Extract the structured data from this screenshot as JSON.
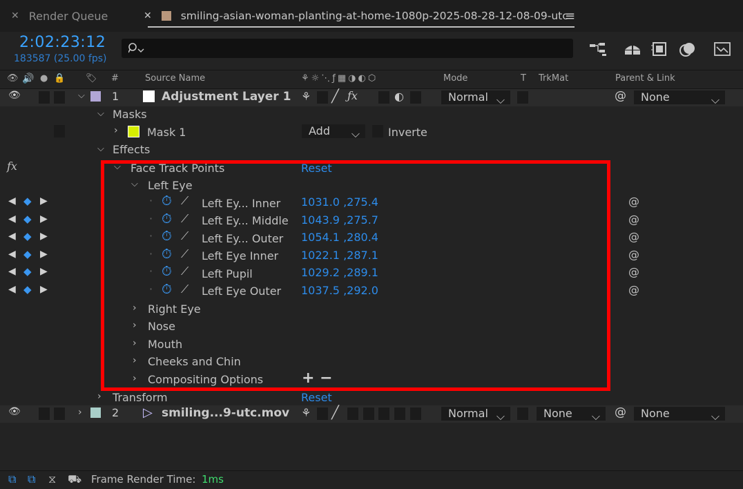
{
  "tabs": {
    "render_queue": "Render Queue",
    "comp": "smiling-asian-woman-planting-at-home-1080p-2025-08-28-12-08-09-utc"
  },
  "timecode": "2:02:23:12",
  "frames": "183587 (25.00 fps)",
  "columns": {
    "hash": "#",
    "source_name": "Source Name",
    "mode": "Mode",
    "t": "T",
    "trkmat": "TrkMat",
    "parent": "Parent & Link"
  },
  "layer1": {
    "num": "1",
    "name": "Adjustment Layer 1",
    "mode": "Normal",
    "parent": "None"
  },
  "masks_label": "Masks",
  "mask1": {
    "name": "Mask 1",
    "mode": "Add",
    "inverted_label": "Inverte",
    "color": "#d6ee00"
  },
  "effects_label": "Effects",
  "fx_label": "fx",
  "effect": {
    "name": "Face Track Points",
    "reset": "Reset"
  },
  "left_eye_group": "Left Eye",
  "left_eye_props": [
    {
      "name": "Left Ey... Inner",
      "value": "1031.0 ,275.4"
    },
    {
      "name": "Left Ey... Middle",
      "value": "1043.9 ,275.7"
    },
    {
      "name": "Left Ey... Outer",
      "value": "1054.1 ,280.4"
    },
    {
      "name": "Left Eye Inner",
      "value": "1022.1 ,287.1"
    },
    {
      "name": "Left Pupil",
      "value": "1029.2 ,289.1"
    },
    {
      "name": "Left Eye Outer",
      "value": "1037.5 ,292.0"
    }
  ],
  "groups": [
    "Right Eye",
    "Nose",
    "Mouth",
    "Cheeks and Chin",
    "Compositing Options"
  ],
  "compositing_buttons": "+ −",
  "transform": {
    "label": "Transform",
    "reset": "Reset"
  },
  "layer2": {
    "num": "2",
    "name": "smiling...9-utc.mov",
    "mode": "Normal",
    "trkmat": "None",
    "parent": "None"
  },
  "status": {
    "label": "Frame Render Time:",
    "value": "1ms"
  },
  "colors": {
    "accent_blue": "#2d8ceb",
    "highlight_red": "#ff0000",
    "status_green": "#3fdc6e"
  }
}
